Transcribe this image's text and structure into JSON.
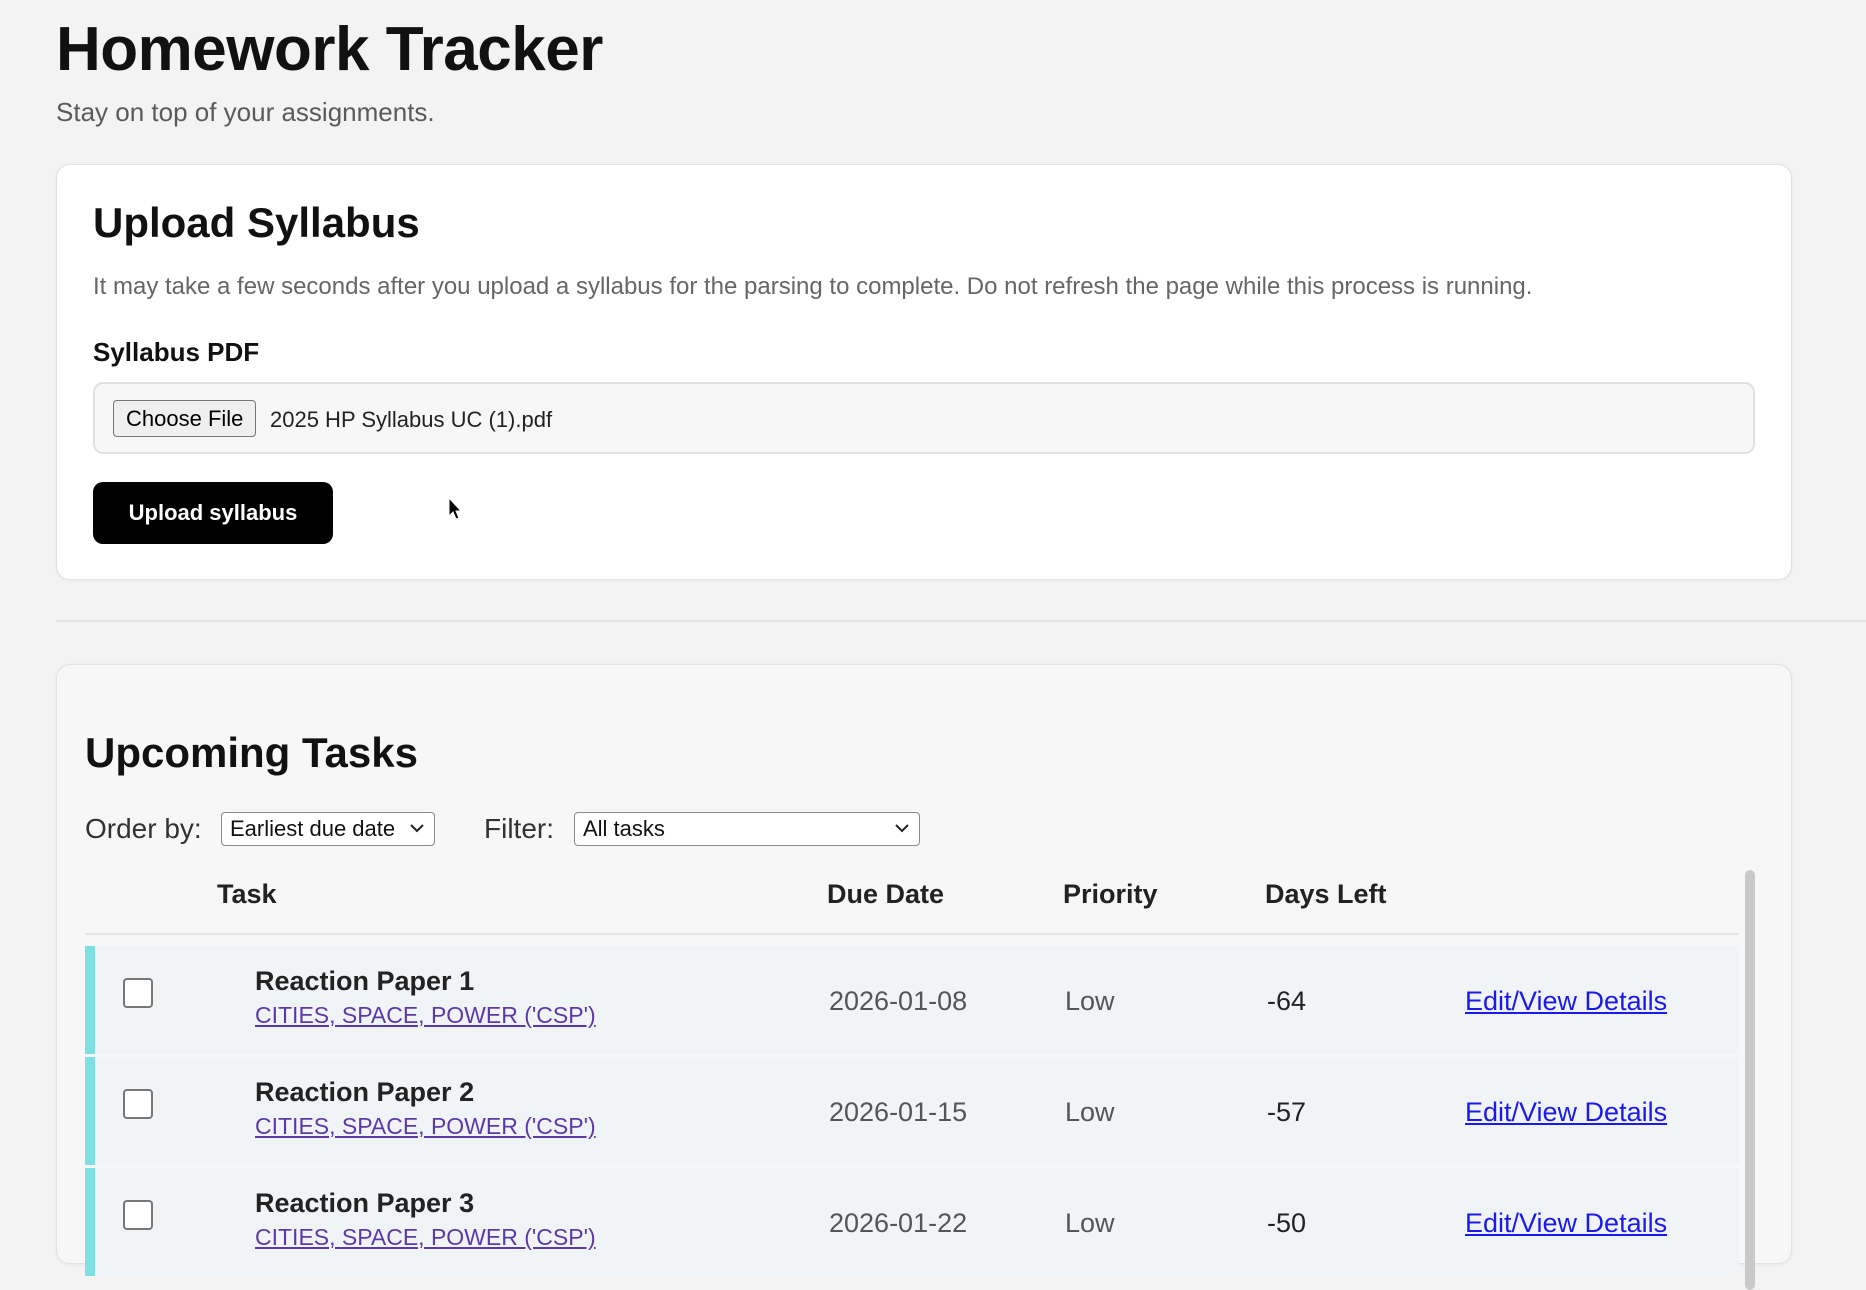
{
  "header": {
    "title": "Homework Tracker",
    "subtitle": "Stay on top of your assignments."
  },
  "upload": {
    "title": "Upload Syllabus",
    "note": "It may take a few seconds after you upload a syllabus for the parsing to complete. Do not refresh the page while this process is running.",
    "field_label": "Syllabus PDF",
    "choose_file_label": "Choose File",
    "file_name": "2025 HP Syllabus UC (1).pdf",
    "submit_label": "Upload syllabus"
  },
  "tasks": {
    "title": "Upcoming Tasks",
    "order_label": "Order by:",
    "order_value": "Earliest due date",
    "filter_label": "Filter:",
    "filter_value": "All tasks",
    "columns": {
      "task": "Task",
      "due": "Due Date",
      "priority": "Priority",
      "days_left": "Days Left"
    },
    "rows": [
      {
        "title": "Reaction Paper 1",
        "course": "CITIES, SPACE, POWER ('CSP')",
        "due": "2026-01-08",
        "priority": "Low",
        "days_left": "-64",
        "action": "Edit/View Details"
      },
      {
        "title": "Reaction Paper 2",
        "course": "CITIES, SPACE, POWER ('CSP')",
        "due": "2026-01-15",
        "priority": "Low",
        "days_left": "-57",
        "action": "Edit/View Details"
      },
      {
        "title": "Reaction Paper 3",
        "course": "CITIES, SPACE, POWER ('CSP')",
        "due": "2026-01-22",
        "priority": "Low",
        "days_left": "-50",
        "action": "Edit/View Details"
      }
    ]
  },
  "colors": {
    "background": "#f3f3f3",
    "primary_button": "#000000",
    "row_accent": "#7fe0e4",
    "course_link": "#5b3aa8",
    "action_link": "#1a1aee"
  }
}
